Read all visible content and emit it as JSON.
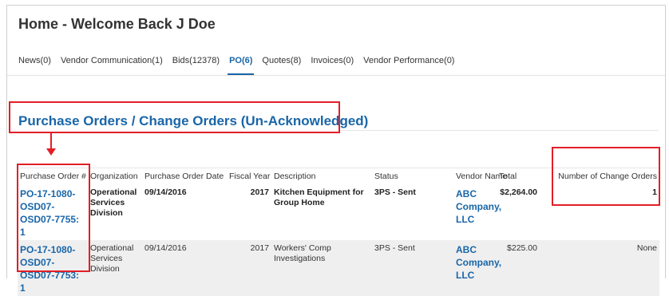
{
  "header": {
    "title": "Home - Welcome Back J Doe"
  },
  "tabs": [
    {
      "label": "News(0)",
      "active": false
    },
    {
      "label": "Vendor Communication(1)",
      "active": false
    },
    {
      "label": "Bids(12378)",
      "active": false
    },
    {
      "label": "PO(6)",
      "active": true
    },
    {
      "label": "Quotes(8)",
      "active": false
    },
    {
      "label": "Invoices(0)",
      "active": false
    },
    {
      "label": "Vendor Performance(0)",
      "active": false
    }
  ],
  "section": {
    "title": "Purchase Orders / Change Orders (Un-Acknowledged)"
  },
  "table": {
    "columns": [
      "Purchase Order #",
      "Organization",
      "Purchase Order Date",
      "Fiscal Year",
      "Description",
      "Status",
      "Vendor Name",
      "Total",
      "Number of Change Orders"
    ],
    "rows": [
      {
        "po_number": "PO-17-1080-OSD07-OSD07-7755: 1",
        "organization": "Operational Services Division",
        "date": "09/14/2016",
        "fiscal_year": "2017",
        "description": "Kitchen Equipment for Group Home",
        "status": "3PS - Sent",
        "vendor": "ABC Company, LLC",
        "total": "$2,264.00",
        "change_orders": "1"
      },
      {
        "po_number": "PO-17-1080-OSD07-OSD07-7753: 1",
        "organization": "Operational Services Division",
        "date": "09/14/2016",
        "fiscal_year": "2017",
        "description": "Workers' Comp Investigations",
        "status": "3PS - Sent",
        "vendor": "ABC Company, LLC",
        "total": "$225.00",
        "change_orders": "None"
      }
    ]
  },
  "colors": {
    "accent": "#1a66a8",
    "highlight": "#e21f26",
    "row_alt": "#efefef"
  }
}
